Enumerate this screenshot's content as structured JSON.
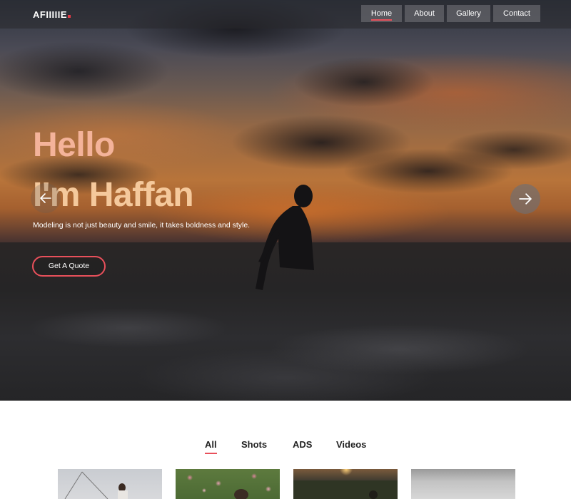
{
  "brand": {
    "logo_text": "AFIIIIIE",
    "accent_color": "#e8505b"
  },
  "nav": {
    "items": [
      {
        "label": "Home",
        "active": true
      },
      {
        "label": "About",
        "active": false
      },
      {
        "label": "Gallery",
        "active": false
      },
      {
        "label": "Contact",
        "active": false
      }
    ]
  },
  "hero": {
    "title_line1": "Hello",
    "title_line2": "I'm Haffan",
    "tagline": "Modeling is not just beauty and smile, it takes boldness and style.",
    "cta_label": "Get A Quote",
    "prev_icon": "arrow-left-icon",
    "next_icon": "arrow-right-icon"
  },
  "gallery": {
    "filters": [
      {
        "label": "All",
        "active": true
      },
      {
        "label": "Shots",
        "active": false
      },
      {
        "label": "ADS",
        "active": false
      },
      {
        "label": "Videos",
        "active": false
      }
    ]
  }
}
